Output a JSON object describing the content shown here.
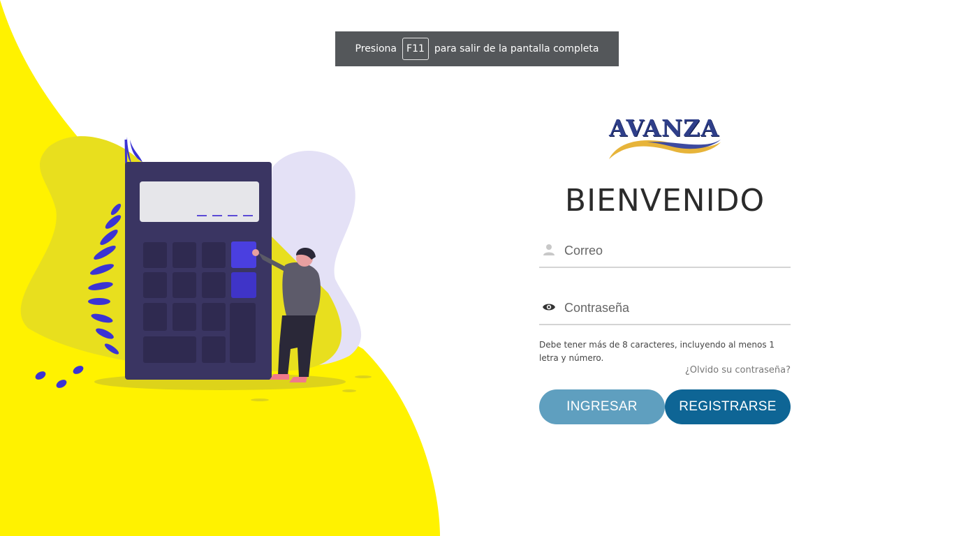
{
  "banner": {
    "prefix": "Presiona",
    "key": "F11",
    "suffix": "para salir de la pantalla completa"
  },
  "brand": {
    "logo_text": "AVANZA"
  },
  "login": {
    "title": "BIENVENIDO",
    "email_placeholder": "Correo",
    "password_placeholder": "Contraseña",
    "password_hint": "Debe tener más de 8 caracteres, incluyendo al menos 1 letra y número.",
    "forgot_link": "¿Olvido su contraseña?",
    "login_button": "INGRESAR",
    "register_button": "REGISTRARSE"
  },
  "colors": {
    "accent_yellow": "#fff200",
    "login_button": "#5f9fbf",
    "register_button": "#0e6595",
    "calculator": "#3a3562"
  },
  "icons": {
    "email": "user-icon",
    "password": "eye-icon"
  }
}
